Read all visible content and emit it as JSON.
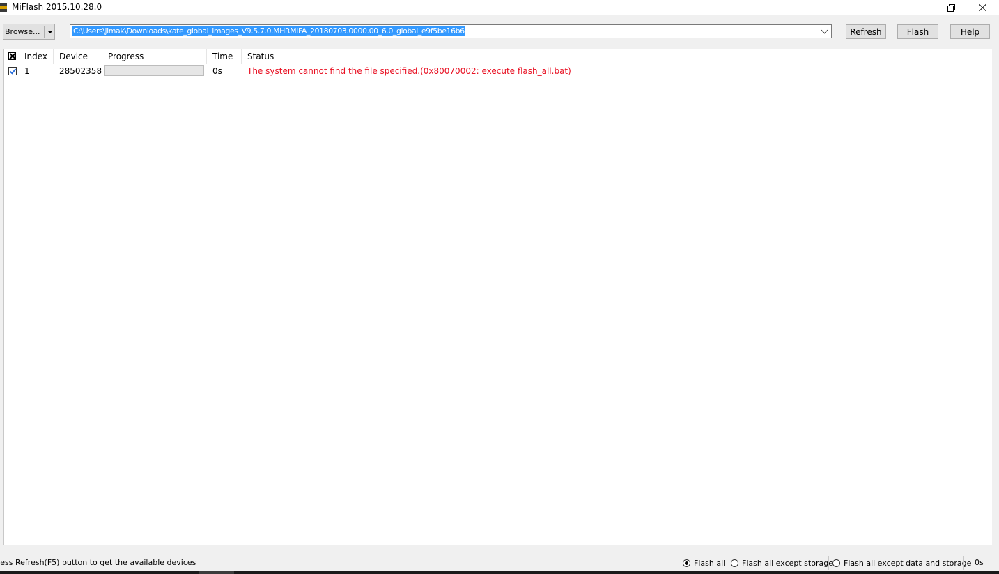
{
  "window": {
    "title": "MiFlash 2015.10.28.0"
  },
  "toolbar": {
    "browse_label": "Browse...",
    "path_value": "C:\\Users\\jimak\\Downloads\\kate_global_images_V9.5.7.0.MHRMIFA_20180703.0000.00_6.0_global_e9f5be16b6",
    "refresh_label": "Refresh",
    "flash_label": "Flash",
    "help_label": "Help"
  },
  "table": {
    "headers": [
      "Index",
      "Device",
      "Progress",
      "Time",
      "Status"
    ],
    "rows": [
      {
        "checked": true,
        "index": "1",
        "device": "28502358",
        "progress": 0,
        "time": "0s",
        "status": "The system cannot find the file specified.(0x80070002: execute flash_all.bat)"
      }
    ]
  },
  "statusbar": {
    "message": "ress Refresh(F5) button to get the available devices",
    "options": [
      {
        "label": "Flash all",
        "checked": true
      },
      {
        "label": "Flash all except storage",
        "checked": false
      },
      {
        "label": "Flash all except data and storage",
        "checked": false
      }
    ],
    "elapsed": "0s"
  },
  "colors": {
    "selection": "#3399ff",
    "error_text": "#e81123",
    "checkbox_tick": "#2a6fdb"
  }
}
